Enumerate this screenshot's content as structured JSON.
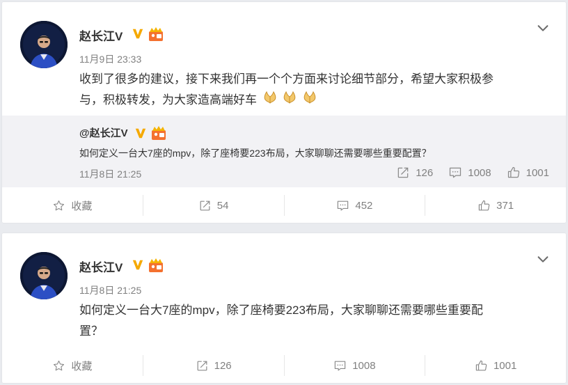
{
  "posts": [
    {
      "author": "赵长江V",
      "time": "11月9日 23:33",
      "text_line1": "收到了很多的建议，接下来我们再一个个方面来讨论细节部分，希望大家积极参",
      "text_line2": "与，积极转发，为大家造高端好车",
      "emoji_icon": "clasped-hands-icon",
      "quote": {
        "author": "@赵长江V",
        "text": "如何定义一台大7座的mpv，除了座椅要223布局，大家聊聊还需要哪些重要配置？",
        "time": "11月8日 21:25",
        "reposts": "126",
        "comments": "1008",
        "likes": "1001"
      },
      "actions": {
        "favorite_label": "收藏",
        "reposts": "54",
        "comments": "452",
        "likes": "371"
      }
    },
    {
      "author": "赵长江V",
      "time": "11月8日 21:25",
      "text_line1": "如何定义一台大7座的mpv，除了座椅要223布局，大家聊聊还需要哪些重要配",
      "text_line2": "置？",
      "actions": {
        "favorite_label": "收藏",
        "reposts": "126",
        "comments": "1008",
        "likes": "1001"
      }
    }
  ],
  "colors": {
    "verified_badge": "#f5a900",
    "level_badge": "#f4712f",
    "accent_text": "#333333",
    "muted_text": "#808080"
  }
}
